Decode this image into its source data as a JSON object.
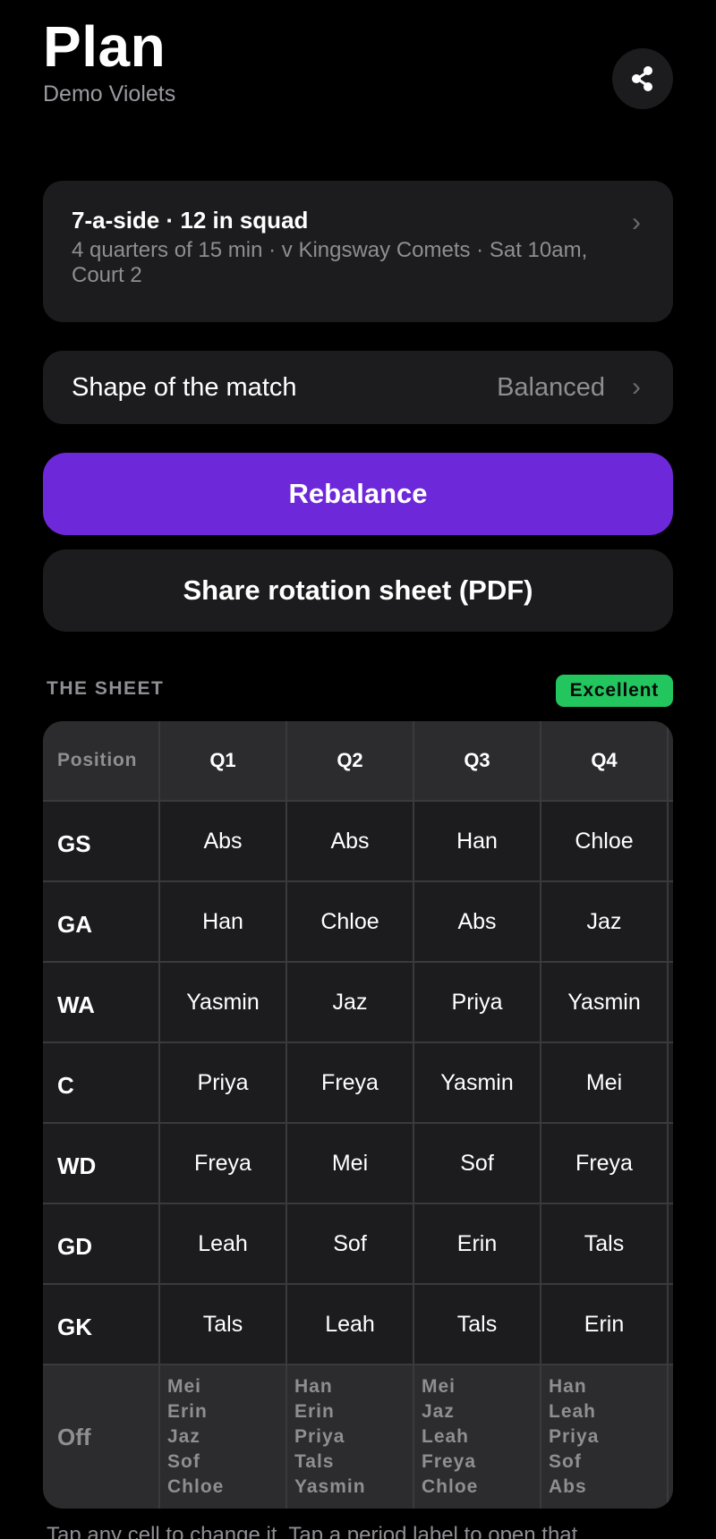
{
  "header": {
    "title": "Plan",
    "subtitle": "Demo Violets",
    "share_icon": "share-icon"
  },
  "match": {
    "title": "7-a-side · 12 in squad",
    "details": "4 quarters of 15 min · v Kingsway Comets · Sat 10am, Court 2",
    "chevron": "›"
  },
  "shape": {
    "label": "Shape of the match",
    "value": "Balanced",
    "chevron": "›"
  },
  "actions": {
    "rebalance": "Rebalance",
    "share_pdf": "Share rotation sheet (PDF)"
  },
  "sheet": {
    "section_label": "THE SHEET",
    "rating": "Excellent",
    "columns": [
      "Position",
      "Q1",
      "Q2",
      "Q3",
      "Q4"
    ],
    "rows": [
      {
        "position": "GS",
        "players": [
          "Abs",
          "Abs",
          "Han",
          "Chloe"
        ]
      },
      {
        "position": "GA",
        "players": [
          "Han",
          "Chloe",
          "Abs",
          "Jaz"
        ]
      },
      {
        "position": "WA",
        "players": [
          "Yasmin",
          "Jaz",
          "Priya",
          "Yasmin"
        ]
      },
      {
        "position": "C",
        "players": [
          "Priya",
          "Freya",
          "Yasmin",
          "Mei"
        ]
      },
      {
        "position": "WD",
        "players": [
          "Freya",
          "Mei",
          "Sof",
          "Freya"
        ]
      },
      {
        "position": "GD",
        "players": [
          "Leah",
          "Sof",
          "Erin",
          "Tals"
        ]
      },
      {
        "position": "GK",
        "players": [
          "Tals",
          "Leah",
          "Tals",
          "Erin"
        ]
      }
    ],
    "off": {
      "label": "Off",
      "quarters": [
        [
          "Mei",
          "Erin",
          "Jaz",
          "Sof",
          "Chloe"
        ],
        [
          "Han",
          "Erin",
          "Priya",
          "Tals",
          "Yasmin"
        ],
        [
          "Mei",
          "Jaz",
          "Leah",
          "Freya",
          "Chloe"
        ],
        [
          "Han",
          "Leah",
          "Priya",
          "Sof",
          "Abs"
        ]
      ]
    }
  },
  "footer": {
    "note": "Tap any cell to change it. Tap a period label to open that"
  },
  "colors": {
    "background": "#000000",
    "card": "#1c1c1e",
    "accent": "#6d28d9",
    "badge": "#22c55e",
    "muted": "#8e8e93"
  }
}
